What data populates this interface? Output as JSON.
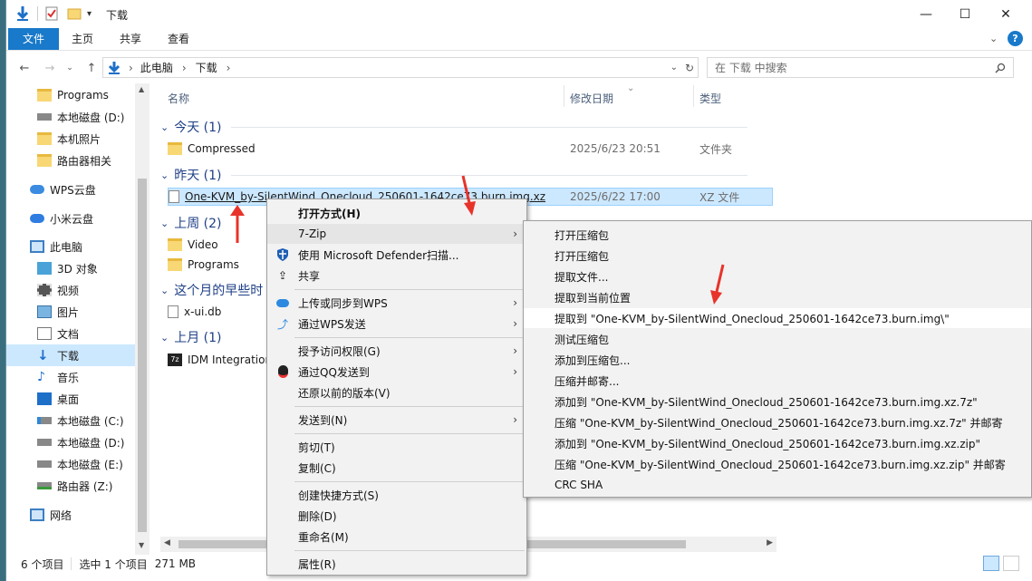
{
  "window": {
    "title": "下载",
    "controls": {
      "minimize": "—",
      "maximize": "☐",
      "close": "✕"
    }
  },
  "ribbon": {
    "tabs": [
      "文件",
      "主页",
      "共享",
      "查看"
    ]
  },
  "address": {
    "path": [
      "此电脑",
      "下载"
    ],
    "search_placeholder": "在 下载 中搜索"
  },
  "nav": {
    "items": [
      {
        "label": "Programs",
        "icon": "folder-icon"
      },
      {
        "label": "本地磁盘 (D:)",
        "icon": "drive-icon"
      },
      {
        "label": "本机照片",
        "icon": "folder-icon"
      },
      {
        "label": "路由器相关",
        "icon": "folder-icon"
      },
      {
        "label": "WPS云盘",
        "icon": "cloud-icon"
      },
      {
        "label": "小米云盘",
        "icon": "cloud-icon"
      },
      {
        "label": "此电脑",
        "icon": "computer-icon"
      },
      {
        "label": "3D 对象",
        "icon": "cube-icon"
      },
      {
        "label": "视频",
        "icon": "video-icon"
      },
      {
        "label": "图片",
        "icon": "picture-icon"
      },
      {
        "label": "文档",
        "icon": "document-icon"
      },
      {
        "label": "下载",
        "icon": "download-icon"
      },
      {
        "label": "音乐",
        "icon": "music-icon"
      },
      {
        "label": "桌面",
        "icon": "desktop-icon"
      },
      {
        "label": "本地磁盘 (C:)",
        "icon": "drive-icon"
      },
      {
        "label": "本地磁盘 (D:)",
        "icon": "drive-icon"
      },
      {
        "label": "本地磁盘 (E:)",
        "icon": "drive-icon"
      },
      {
        "label": "路由器 (Z:)",
        "icon": "network-drive-icon"
      },
      {
        "label": "网络",
        "icon": "network-icon"
      }
    ]
  },
  "columns": {
    "name": "名称",
    "date": "修改日期",
    "type": "类型"
  },
  "groups": [
    {
      "label": "今天 (1)"
    },
    {
      "label": "昨天 (1)"
    },
    {
      "label": "上周 (2)"
    },
    {
      "label": "这个月的早些时"
    },
    {
      "label": "上月 (1)"
    }
  ],
  "files": [
    {
      "name": "Compressed",
      "date": "2025/6/23 20:51",
      "type": "文件夹"
    },
    {
      "name": "One-KVM_by-SilentWind_Onecloud_250601-1642ce73.burn.img.xz",
      "date": "2025/6/22 17:00",
      "type": "XZ 文件"
    },
    {
      "name": "Video",
      "date": "",
      "type": ""
    },
    {
      "name": "Programs",
      "date": "",
      "type": ""
    },
    {
      "name": "x-ui.db",
      "date": "",
      "type": ""
    },
    {
      "name": "IDM Integration",
      "date": "",
      "type": ""
    }
  ],
  "status": {
    "count": "6 个项目",
    "selection": "选中 1 个项目",
    "size": "271 MB"
  },
  "context_menu": {
    "items": [
      {
        "label": "打开方式(H)",
        "bold": true
      },
      {
        "label": "7-Zip",
        "submenu": true
      },
      {
        "label": "使用 Microsoft Defender扫描...",
        "icon": "defender-icon"
      },
      {
        "label": "共享",
        "icon": "share-icon"
      },
      {
        "label": "上传或同步到WPS",
        "icon": "wps-cloud-icon",
        "submenu": true
      },
      {
        "label": "通过WPS发送",
        "icon": "wps-send-icon",
        "submenu": true
      },
      {
        "label": "授予访问权限(G)",
        "submenu": true
      },
      {
        "label": "通过QQ发送到",
        "icon": "qq-icon",
        "submenu": true
      },
      {
        "label": "还原以前的版本(V)"
      },
      {
        "label": "发送到(N)",
        "submenu": true
      },
      {
        "label": "剪切(T)"
      },
      {
        "label": "复制(C)"
      },
      {
        "label": "创建快捷方式(S)"
      },
      {
        "label": "删除(D)"
      },
      {
        "label": "重命名(M)"
      },
      {
        "label": "属性(R)"
      }
    ]
  },
  "zip_submenu": {
    "items": [
      "打开压缩包",
      "打开压缩包",
      "提取文件...",
      "提取到当前位置",
      "提取到 \"One-KVM_by-SilentWind_Onecloud_250601-1642ce73.burn.img\\\"",
      "测试压缩包",
      "添加到压缩包...",
      "压缩并邮寄...",
      "添加到 \"One-KVM_by-SilentWind_Onecloud_250601-1642ce73.burn.img.xz.7z\"",
      "压缩 \"One-KVM_by-SilentWind_Onecloud_250601-1642ce73.burn.img.xz.7z\" 并邮寄",
      "添加到 \"One-KVM_by-SilentWind_Onecloud_250601-1642ce73.burn.img.xz.zip\"",
      "压缩 \"One-KVM_by-SilentWind_Onecloud_250601-1642ce73.burn.img.xz.zip\" 并邮寄",
      "CRC SHA"
    ]
  },
  "colors": {
    "accent": "#1979ca",
    "selection": "#cce8ff",
    "arrow": "#e8332a"
  }
}
